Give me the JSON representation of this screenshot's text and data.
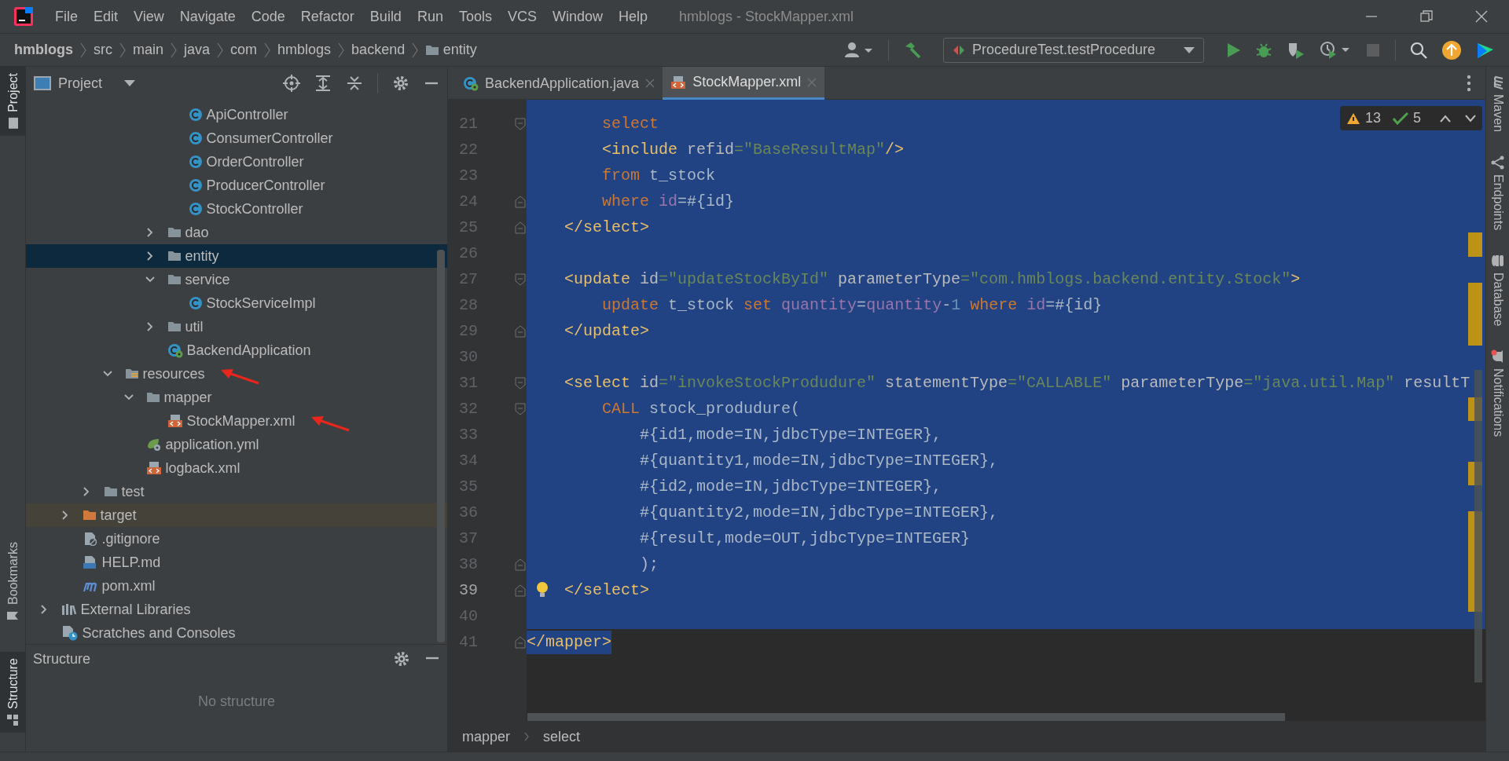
{
  "window": {
    "title": "hmblogs - StockMapper.xml"
  },
  "menu": [
    "File",
    "Edit",
    "View",
    "Navigate",
    "Code",
    "Refactor",
    "Build",
    "Run",
    "Tools",
    "VCS",
    "Window",
    "Help"
  ],
  "breadcrumbs": [
    {
      "label": "hmblogs",
      "kind": "project"
    },
    {
      "label": "src",
      "kind": "dir"
    },
    {
      "label": "main",
      "kind": "dir"
    },
    {
      "label": "java",
      "kind": "dir"
    },
    {
      "label": "com",
      "kind": "dir"
    },
    {
      "label": "hmblogs",
      "kind": "dir"
    },
    {
      "label": "backend",
      "kind": "dir"
    },
    {
      "label": "entity",
      "kind": "folder"
    }
  ],
  "run_config": {
    "label": "ProcedureTest.testProcedure"
  },
  "left_stripe": [
    {
      "label": "Project",
      "kind": "project",
      "selected": true
    },
    {
      "label": "Bookmarks",
      "kind": "bookmarks",
      "selected": false
    },
    {
      "label": "Structure",
      "kind": "structure",
      "selected": true
    }
  ],
  "project_panel": {
    "title": "Project",
    "tree": [
      {
        "children": [
          {
            "children": [
              {
                "children": [
                  {
                    "children": [
                      {
                        "children": [
                          {
                            "children": [
                              {
                                "label": "ApiController",
                                "kind": "class",
                                "selected": false,
                                "marked": false
                              },
                              {
                                "label": "ConsumerController",
                                "kind": "class",
                                "selected": false,
                                "marked": false
                              },
                              {
                                "label": "OrderController",
                                "kind": "class",
                                "selected": false,
                                "marked": false
                              },
                              {
                                "label": "ProducerController",
                                "kind": "class",
                                "selected": false,
                                "marked": false
                              },
                              {
                                "label": "StockController",
                                "kind": "class",
                                "selected": false,
                                "marked": false
                              }
                            ]
                          },
                          {
                            "label": "dao",
                            "kind": "folder",
                            "expanded": false,
                            "selected": false,
                            "marked": false
                          },
                          {
                            "label": "entity",
                            "kind": "folder",
                            "expanded": false,
                            "selected": true,
                            "marked": false
                          },
                          {
                            "label": "service",
                            "kind": "folder",
                            "expanded": true,
                            "selected": false,
                            "marked": false,
                            "children": [
                              {
                                "label": "StockServiceImpl",
                                "kind": "class",
                                "selected": false,
                                "marked": false
                              }
                            ]
                          },
                          {
                            "label": "util",
                            "kind": "folder",
                            "expanded": false,
                            "selected": false,
                            "marked": false
                          },
                          {
                            "label": "BackendApplication",
                            "kind": "spring",
                            "selected": false,
                            "marked": false
                          }
                        ]
                      }
                    ]
                  },
                  {
                    "label": "resources",
                    "kind": "resources",
                    "expanded": true,
                    "selected": false,
                    "marked": true,
                    "children": [
                      {
                        "label": "mapper",
                        "kind": "folder",
                        "expanded": true,
                        "selected": false,
                        "marked": false,
                        "children": [
                          {
                            "label": "StockMapper.xml",
                            "kind": "xml",
                            "selected": false,
                            "marked": true
                          }
                        ]
                      },
                      {
                        "label": "application.yml",
                        "kind": "yml",
                        "selected": false,
                        "marked": false
                      },
                      {
                        "label": "logback.xml",
                        "kind": "xml",
                        "selected": false,
                        "marked": false
                      }
                    ]
                  }
                ]
              },
              {
                "label": "test",
                "kind": "folder",
                "expanded": false,
                "selected": false,
                "marked": false
              }
            ]
          },
          {
            "label": "target",
            "kind": "excluded",
            "expanded": false,
            "selected": false,
            "marked": false
          },
          {
            "label": ".gitignore",
            "kind": "ignore",
            "selected": false,
            "marked": false
          },
          {
            "label": "HELP.md",
            "kind": "md",
            "selected": false,
            "marked": false
          },
          {
            "label": "pom.xml",
            "kind": "maven",
            "selected": false,
            "marked": false
          }
        ]
      },
      {
        "label": "External Libraries",
        "kind": "libraries",
        "expanded": false,
        "selected": false,
        "marked": false
      },
      {
        "label": "Scratches and Consoles",
        "kind": "scratches",
        "selected": false,
        "marked": false
      }
    ]
  },
  "structure_panel": {
    "title": "Structure",
    "empty_text": "No structure"
  },
  "editor": {
    "tabs": [
      {
        "label": "BackendApplication.java",
        "kind": "spring",
        "selected": false
      },
      {
        "label": "StockMapper.xml",
        "kind": "xml",
        "selected": true
      }
    ],
    "inspections": {
      "warnings": "13",
      "weak_warnings": "5"
    },
    "lines": [
      {
        "number": "21",
        "selected": true,
        "current": false,
        "fold_marker": true,
        "fold_end": false,
        "tokens": [
          {
            "kind": "keyword",
            "text": "        select"
          }
        ]
      },
      {
        "number": "22",
        "selected": true,
        "current": false,
        "fold_marker": false,
        "tokens": [
          {
            "kind": "tag",
            "text": "        <include "
          },
          {
            "kind": "attr",
            "text": "refid"
          },
          {
            "kind": "value",
            "text": "=\"BaseResultMap\""
          },
          {
            "kind": "tag",
            "text": "/>"
          }
        ]
      },
      {
        "number": "23",
        "selected": true,
        "current": false,
        "fold_marker": false,
        "tokens": [
          {
            "kind": "keyword",
            "text": "        from"
          },
          {
            "kind": "plain",
            "text": " t_stock"
          }
        ]
      },
      {
        "number": "24",
        "selected": true,
        "current": false,
        "fold_marker": true,
        "fold_end": true,
        "tokens": [
          {
            "kind": "keyword",
            "text": "        where"
          },
          {
            "kind": "column",
            "text": " id"
          },
          {
            "kind": "plain",
            "text": "=#{id}"
          }
        ]
      },
      {
        "number": "25",
        "selected": true,
        "current": false,
        "fold_marker": true,
        "fold_end": true,
        "tokens": [
          {
            "kind": "tag",
            "text": "    </select>"
          }
        ]
      },
      {
        "number": "26",
        "selected": true,
        "current": false,
        "fold_marker": false
      },
      {
        "number": "27",
        "selected": true,
        "current": false,
        "fold_marker": true,
        "fold_end": false,
        "tokens": [
          {
            "kind": "tag",
            "text": "    <update "
          },
          {
            "kind": "attr",
            "text": "id"
          },
          {
            "kind": "value",
            "text": "=\"updateStockById\""
          },
          {
            "kind": "attr",
            "text": " parameterType"
          },
          {
            "kind": "value",
            "text": "=\"com.hmblogs.backend.entity.Stock\""
          },
          {
            "kind": "tag",
            "text": ">"
          }
        ]
      },
      {
        "number": "28",
        "selected": true,
        "current": false,
        "fold_marker": false,
        "tokens": [
          {
            "kind": "keyword",
            "text": "        update"
          },
          {
            "kind": "plain",
            "text": " t_stock "
          },
          {
            "kind": "keyword",
            "text": "set"
          },
          {
            "kind": "column",
            "text": " quantity"
          },
          {
            "kind": "plain",
            "text": "="
          },
          {
            "kind": "column",
            "text": "quantity"
          },
          {
            "kind": "plain",
            "text": "-"
          },
          {
            "kind": "number",
            "text": "1"
          },
          {
            "kind": "keyword",
            "text": " where"
          },
          {
            "kind": "column",
            "text": " id"
          },
          {
            "kind": "plain",
            "text": "=#{id}"
          }
        ]
      },
      {
        "number": "29",
        "selected": true,
        "current": false,
        "fold_marker": true,
        "fold_end": true,
        "tokens": [
          {
            "kind": "tag",
            "text": "    </update>"
          }
        ]
      },
      {
        "number": "30",
        "selected": true,
        "current": false,
        "fold_marker": false
      },
      {
        "number": "31",
        "selected": true,
        "current": false,
        "fold_marker": true,
        "fold_end": false,
        "tokens": [
          {
            "kind": "tag",
            "text": "    <select "
          },
          {
            "kind": "attr",
            "text": "id"
          },
          {
            "kind": "value",
            "text": "=\"invokeStockProdudure\""
          },
          {
            "kind": "attr",
            "text": " statementType"
          },
          {
            "kind": "value",
            "text": "=\"CALLABLE\""
          },
          {
            "kind": "attr",
            "text": " parameterType"
          },
          {
            "kind": "value",
            "text": "=\"java.util.Map\""
          },
          {
            "kind": "attr",
            "text": " resultT"
          }
        ]
      },
      {
        "number": "32",
        "selected": true,
        "current": false,
        "fold_marker": true,
        "fold_end": false,
        "tokens": [
          {
            "kind": "keyword",
            "text": "        CALL"
          },
          {
            "kind": "plain",
            "text": " stock_produdure("
          }
        ]
      },
      {
        "number": "33",
        "selected": true,
        "current": false,
        "fold_marker": false,
        "tokens": [
          {
            "kind": "plain",
            "text": "            #{id1,mode=IN,jdbcType=INTEGER},"
          }
        ]
      },
      {
        "number": "34",
        "selected": true,
        "current": false,
        "fold_marker": false,
        "tokens": [
          {
            "kind": "plain",
            "text": "            #{quantity1,mode=IN,jdbcType=INTEGER},"
          }
        ]
      },
      {
        "number": "35",
        "selected": true,
        "current": false,
        "fold_marker": false,
        "tokens": [
          {
            "kind": "plain",
            "text": "            #{id2,mode=IN,jdbcType=INTEGER},"
          }
        ]
      },
      {
        "number": "36",
        "selected": true,
        "current": false,
        "fold_marker": false,
        "tokens": [
          {
            "kind": "plain",
            "text": "            #{quantity2,mode=IN,jdbcType=INTEGER},"
          }
        ]
      },
      {
        "number": "37",
        "selected": true,
        "current": false,
        "fold_marker": false,
        "tokens": [
          {
            "kind": "plain",
            "text": "            #{result,mode=OUT,jdbcType=INTEGER}"
          }
        ]
      },
      {
        "number": "38",
        "selected": true,
        "current": false,
        "fold_marker": true,
        "fold_end": true,
        "tokens": [
          {
            "kind": "plain",
            "text": "            );"
          }
        ]
      },
      {
        "number": "39",
        "selected": true,
        "current": true,
        "fold_marker": true,
        "fold_end": true,
        "bulb": true,
        "tokens": [
          {
            "kind": "tag",
            "text": "    </select>"
          }
        ]
      },
      {
        "number": "40",
        "selected": true,
        "current": false,
        "fold_marker": false
      },
      {
        "number": "41",
        "selected": false,
        "text_selected": true,
        "current": false,
        "fold_marker": true,
        "fold_end": true,
        "tokens": [
          {
            "kind": "tag",
            "text": "</mapper>"
          }
        ]
      }
    ],
    "breadcrumbs": [
      "mapper",
      "select"
    ]
  },
  "right_stripe": [
    {
      "label": "Maven",
      "kind": "maven"
    },
    {
      "label": "Endpoints",
      "kind": "endpoints"
    },
    {
      "label": "Database",
      "kind": "database"
    },
    {
      "label": "Notifications",
      "kind": "notifications"
    }
  ]
}
